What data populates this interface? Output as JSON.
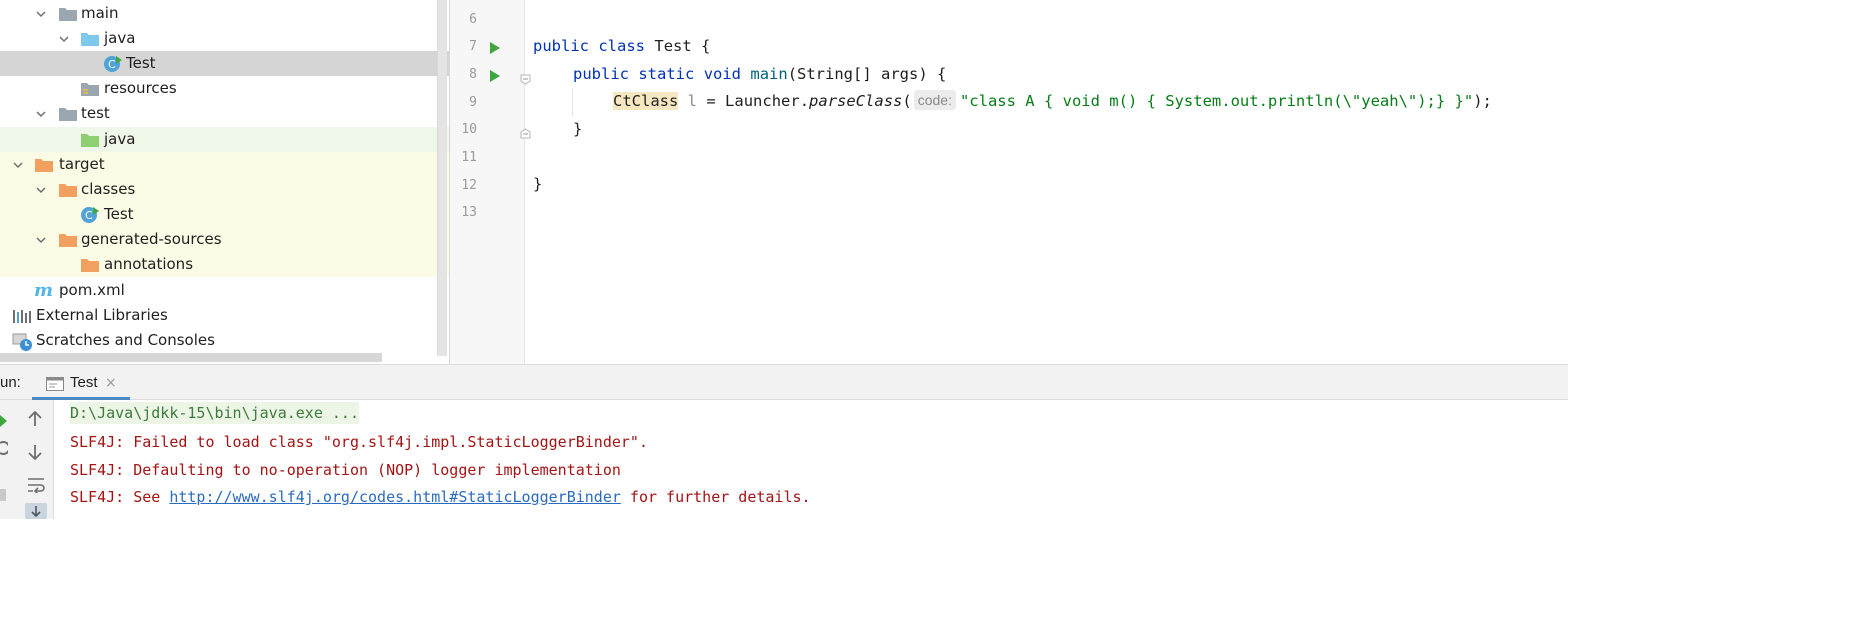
{
  "project_tree": {
    "items": [
      {
        "label": "main",
        "icon": "folder-gray-icon",
        "expanded": true
      },
      {
        "label": "java",
        "icon": "folder-blue-source-icon",
        "expanded": true
      },
      {
        "label": "Test",
        "icon": "java-class-icon",
        "selected": true
      },
      {
        "label": "resources",
        "icon": "folder-resources-icon"
      },
      {
        "label": "test",
        "icon": "folder-gray-icon",
        "expanded": true
      },
      {
        "label": "java",
        "icon": "folder-green-test-icon"
      },
      {
        "label": "target",
        "icon": "folder-orange-icon",
        "expanded": true
      },
      {
        "label": "classes",
        "icon": "folder-orange-icon",
        "expanded": true
      },
      {
        "label": "Test",
        "icon": "java-class-icon"
      },
      {
        "label": "generated-sources",
        "icon": "folder-orange-icon",
        "expanded": true
      },
      {
        "label": "annotations",
        "icon": "folder-orange-icon"
      },
      {
        "label": "pom.xml",
        "icon": "maven-icon"
      },
      {
        "label": "External Libraries",
        "icon": "libraries-icon"
      },
      {
        "label": "Scratches and Consoles",
        "icon": "scratches-icon"
      }
    ]
  },
  "editor": {
    "line_numbers": [
      "6",
      "7",
      "8",
      "9",
      "10",
      "11",
      "12",
      "13"
    ],
    "lines": {
      "l7": {
        "kw1": "public",
        "kw2": "class",
        "name": "Test",
        "brace": "{"
      },
      "l8": {
        "kw1": "public",
        "kw2": "static",
        "kw3": "void",
        "method": "main",
        "params": "(String[] args) {"
      },
      "l9": {
        "type": "CtClass",
        "var": "l",
        "eq": "=",
        "recv": "Launcher.",
        "call": "parseClass",
        "open": "(",
        "hint": "code:",
        "str": "\"class A { void m() { System.out.println(\\\"yeah\\\");} }\"",
        "close": ");"
      },
      "l10": {
        "brace": "}"
      },
      "l12": {
        "brace": "}"
      }
    }
  },
  "run_panel": {
    "prefix": "un:",
    "tab_label": "Test",
    "tab_close": "×",
    "console_lines": {
      "cmd": "D:\\Java\\jdkk-15\\bin\\java.exe ...",
      "err1": "SLF4J: Failed to load class \"org.slf4j.impl.StaticLoggerBinder\".",
      "err2": "SLF4J: Defaulting to no-operation (NOP) logger implementation",
      "err3_prefix": "SLF4J: See ",
      "err3_link": "http://www.slf4j.org/codes.html#StaticLoggerBinder",
      "err3_suffix": " for further details."
    }
  },
  "colors": {
    "keyword": "#0033b3",
    "string": "#067d17",
    "error": "#a31515",
    "link": "#2b6bbf",
    "selection": "#d5d5d5",
    "tab_underline": "#4a88c7"
  }
}
